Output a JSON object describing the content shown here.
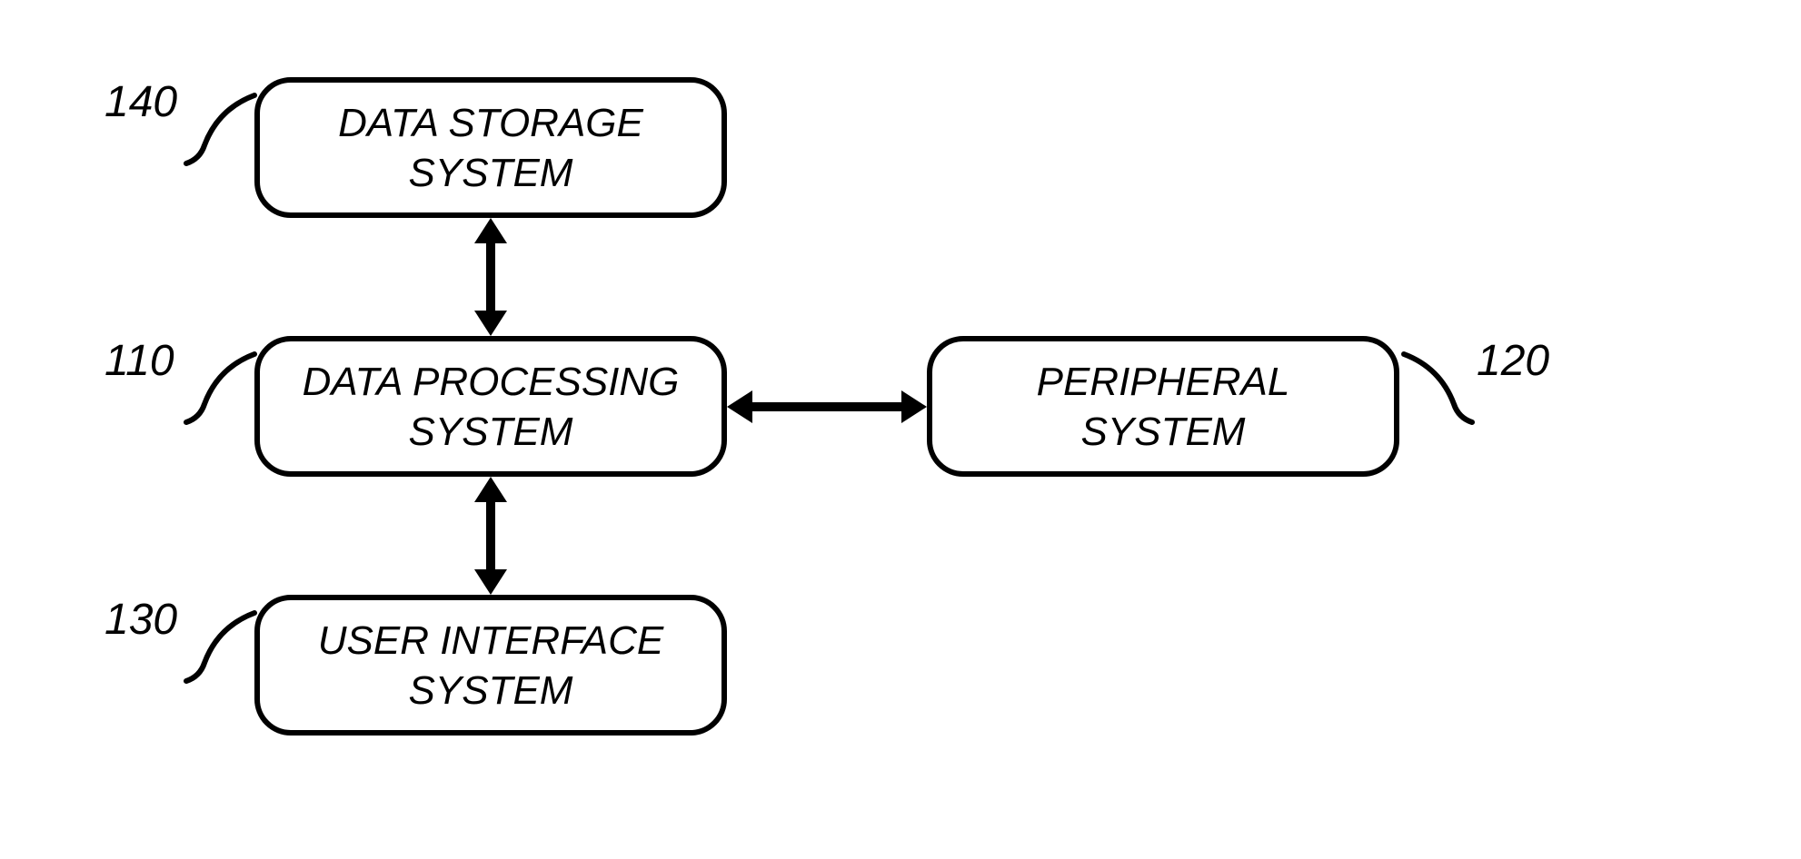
{
  "boxes": {
    "data_storage": {
      "ref": "140",
      "line1": "DATA STORAGE",
      "line2": "SYSTEM"
    },
    "data_processing": {
      "ref": "110",
      "line1": "DATA PROCESSING",
      "line2": "SYSTEM"
    },
    "peripheral": {
      "ref": "120",
      "line1": "PERIPHERAL",
      "line2": "SYSTEM"
    },
    "user_interface": {
      "ref": "130",
      "line1": "USER INTERFACE",
      "line2": "SYSTEM"
    }
  }
}
